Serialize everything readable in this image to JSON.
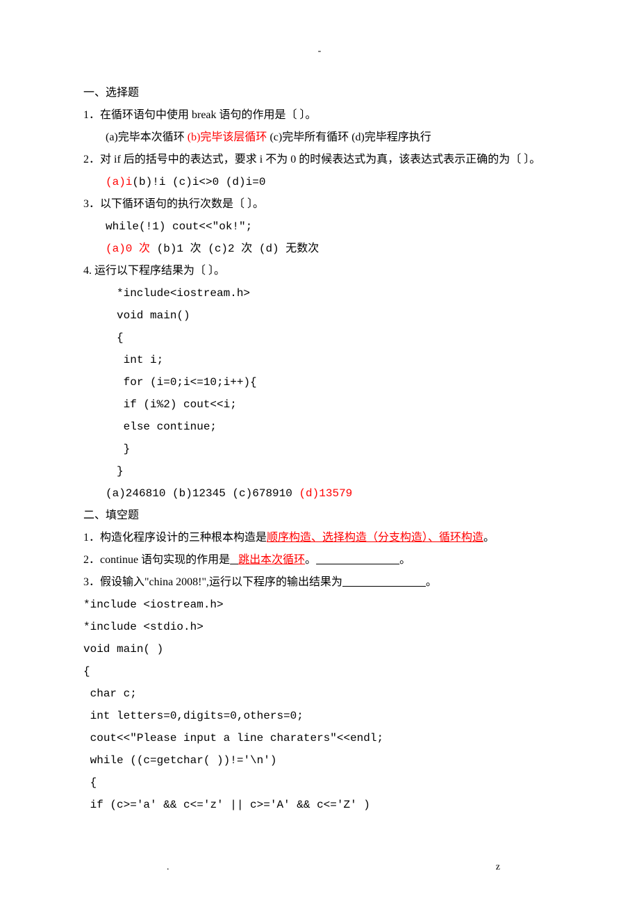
{
  "topDash": "-",
  "section1": {
    "title": "一、选择题",
    "q1": {
      "stem": "1．在循环语句中使用 break 语句的作用是〔 〕。",
      "a": "(a)完毕本次循环 ",
      "b": "(b)完毕该层循环",
      "c": " (c)完毕所有循环 (d)完毕程序执行"
    },
    "q2": {
      "stem": "2．对 if 后的括号中的表达式，要求 i 不为 0 的时候表达式为真，该表达式表示正确的为〔 〕。",
      "a": "(a)i",
      "rest": "(b)!i (c)i<>0 (d)i=0"
    },
    "q3": {
      "stem": "3．以下循环语句的执行次数是〔 〕。",
      "code": "while(!1) cout<<\"ok!\";",
      "a": "(a)0 次",
      "rest": " (b)1 次 (c)2 次 (d) 无数次"
    },
    "q4": {
      "stem": "4. 运行以下程序结果为〔 〕。",
      "code": [
        "*include<iostream.h>",
        "void main()",
        "{",
        " int i;",
        " for (i=0;i<=10;i++){",
        " if (i%2) cout<<i;",
        " else continue;",
        " }",
        "}"
      ],
      "optsPrefix": "(a)246810 (b)12345 (c)678910 ",
      "d": "(d)13579"
    }
  },
  "section2": {
    "title": "二、填空题",
    "q1": {
      "pre": "1．构造化程序设计的三种根本构造是",
      "ans": "顺序构造、选择构造（分支构造）、循环构造",
      "post": "。"
    },
    "q2": {
      "pre": "2．continue 语句实现的作用是",
      "blank1": "   ",
      "ans": "跳出本次循环",
      "mid": "。",
      "blank2": "                              ",
      "post": "。"
    },
    "q3": {
      "pre": "3．假设输入\"china 2008!\",运行以下程序的输出结果为",
      "blank": "                              ",
      "post": "。"
    },
    "code": [
      "*include <iostream.h>",
      "*include <stdio.h>",
      "void main( )",
      "{",
      " char c;",
      " int letters=0,digits=0,others=0;",
      " cout<<\"Please input a line charaters\"<<endl;",
      " while ((c=getchar( ))!='\\n')",
      " {",
      " if (c>='a' && c<='z' || c>='A' && c<='Z' )"
    ]
  },
  "footer": {
    "left": ".",
    "right": "z"
  }
}
